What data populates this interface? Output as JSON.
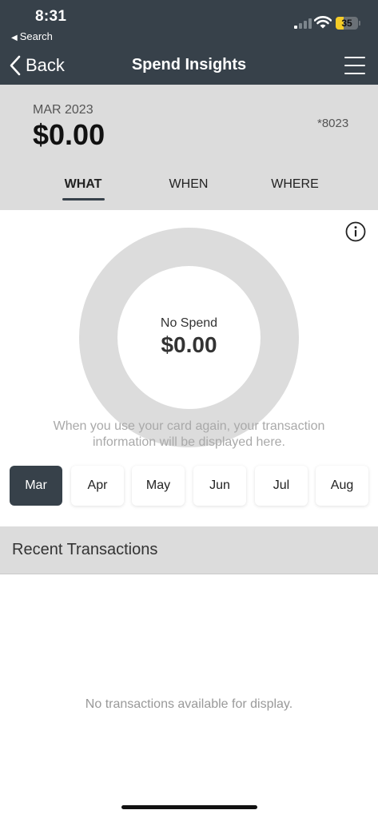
{
  "status_bar": {
    "time": "8:31",
    "back_app": "Search",
    "battery": "35"
  },
  "nav": {
    "back_label": "Back",
    "title": "Spend Insights"
  },
  "summary": {
    "period": "MAR 2023",
    "total": "$0.00",
    "card_number": "*8023"
  },
  "tabs": [
    {
      "label": "WHAT",
      "active": true
    },
    {
      "label": "WHEN",
      "active": false
    },
    {
      "label": "WHERE",
      "active": false
    }
  ],
  "donut": {
    "label": "No Spend",
    "value": "$0.00",
    "ring_color": "#dcdcdc"
  },
  "empty_message": "When you use your card again, your transaction information will be displayed here.",
  "months": [
    {
      "label": "Mar",
      "active": true
    },
    {
      "label": "Apr",
      "active": false
    },
    {
      "label": "May",
      "active": false
    },
    {
      "label": "Jun",
      "active": false
    },
    {
      "label": "Jul",
      "active": false
    },
    {
      "label": "Aug",
      "active": false
    }
  ],
  "recent": {
    "title": "Recent Transactions",
    "empty": "No transactions available for display."
  },
  "colors": {
    "header_bg": "#37414a",
    "summary_bg": "#dcdcdc",
    "active_chip": "#37414a"
  }
}
